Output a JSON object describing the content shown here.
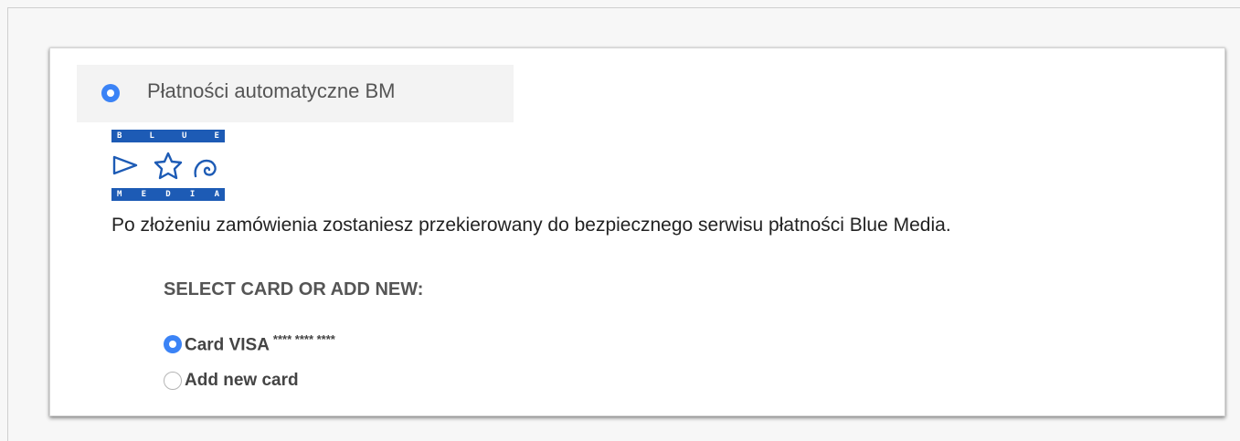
{
  "payment_method": {
    "label": "Płatności automatyczne BM",
    "selected": true
  },
  "logo": {
    "top_letters": [
      "B",
      "L",
      "U",
      "E"
    ],
    "bottom_letters": [
      "M",
      "E",
      "D",
      "I",
      "A"
    ],
    "icons": [
      "play-triangle-icon",
      "star-icon",
      "spiral-icon"
    ],
    "color": "#1d5bb5"
  },
  "description": "Po złożeniu zamówienia zostaniesz przekierowany do bezpiecznego serwisu płatności Blue Media.",
  "cards": {
    "title": "SELECT CARD OR ADD NEW:",
    "options": [
      {
        "label": "Card VISA",
        "masked_number": "**** **** ****",
        "selected": true
      },
      {
        "label": "Add new card",
        "selected": false
      }
    ]
  },
  "colors": {
    "accent": "#3b83f6",
    "header_bg": "#f3f3f3"
  }
}
